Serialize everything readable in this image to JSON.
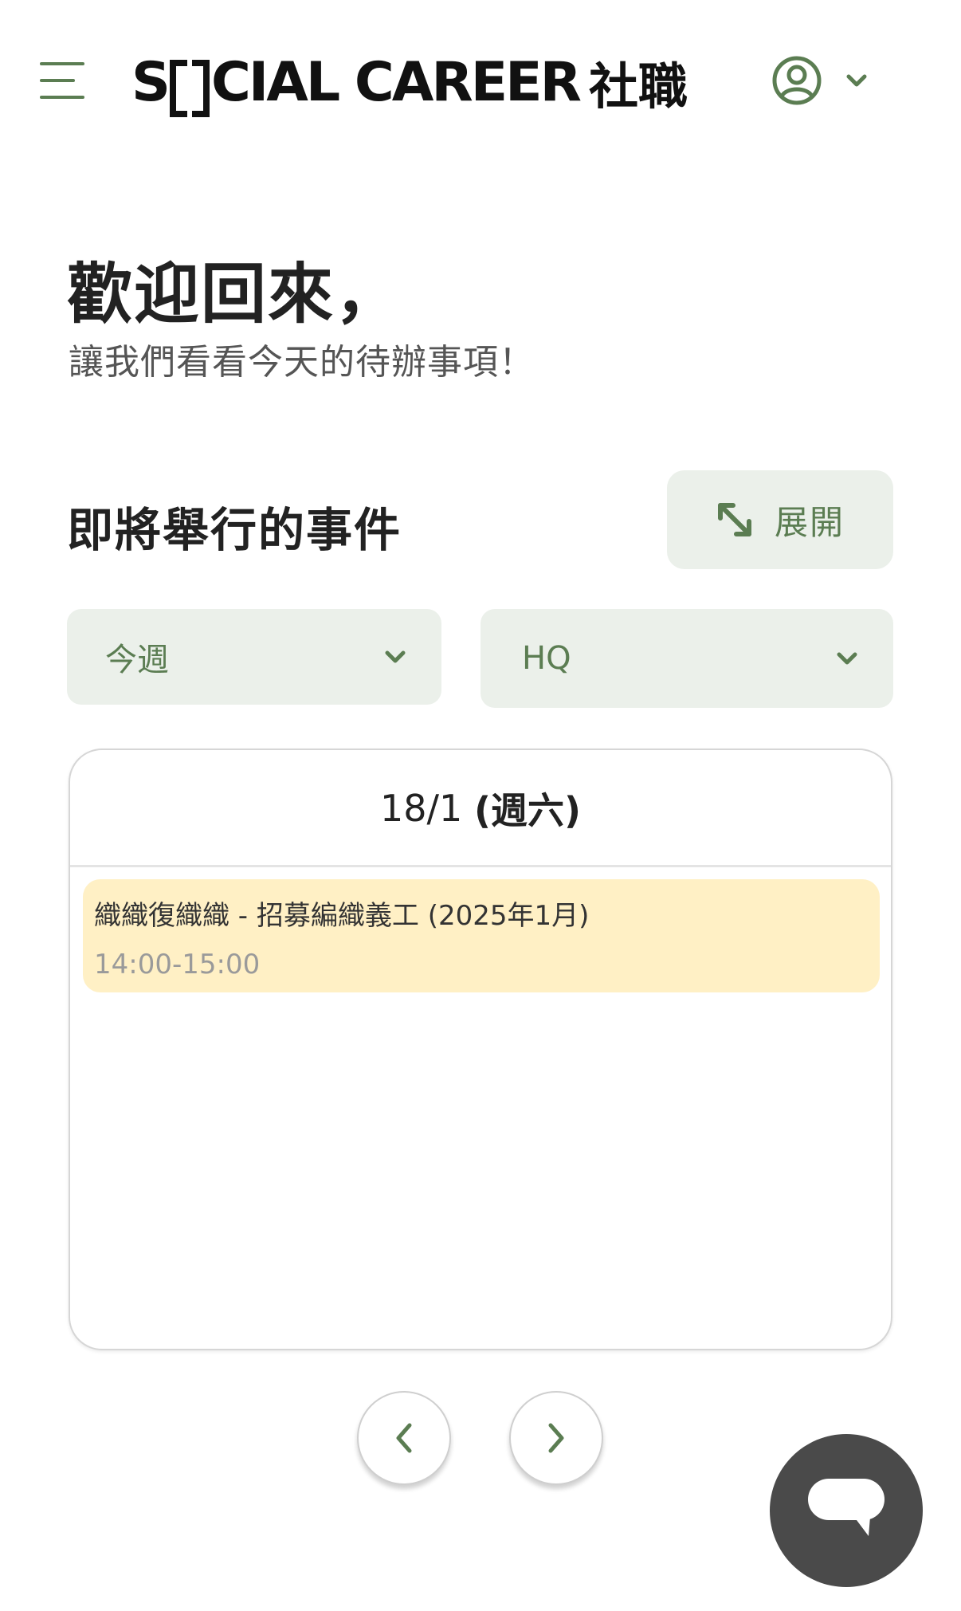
{
  "header": {
    "logo_prefix": "S",
    "logo_suffix": "CIAL CAREER",
    "logo_cjk": "社職",
    "icons": {
      "menu": "hamburger-menu-icon",
      "user": "user-circle-icon",
      "dropdown": "chevron-down-icon"
    }
  },
  "welcome": {
    "title": "歡迎回來，",
    "subtitle": "讓我們看看今天的待辦事項！"
  },
  "events": {
    "section_title": "即將舉行的事件",
    "expand_label": "展開",
    "period_filter": "今週",
    "location_filter": "HQ",
    "date_header_num": "18/1",
    "date_header_day": "(週六)",
    "items": [
      {
        "title": "織織復織織 - 招募編織義工 (2025年1月)",
        "time": "14:00-15:00"
      }
    ]
  },
  "colors": {
    "accent": "#5b7d52",
    "filter_bg": "#ebf0ea",
    "event_bg": "#fff0c5",
    "chat_fab": "#4a4a4a"
  }
}
